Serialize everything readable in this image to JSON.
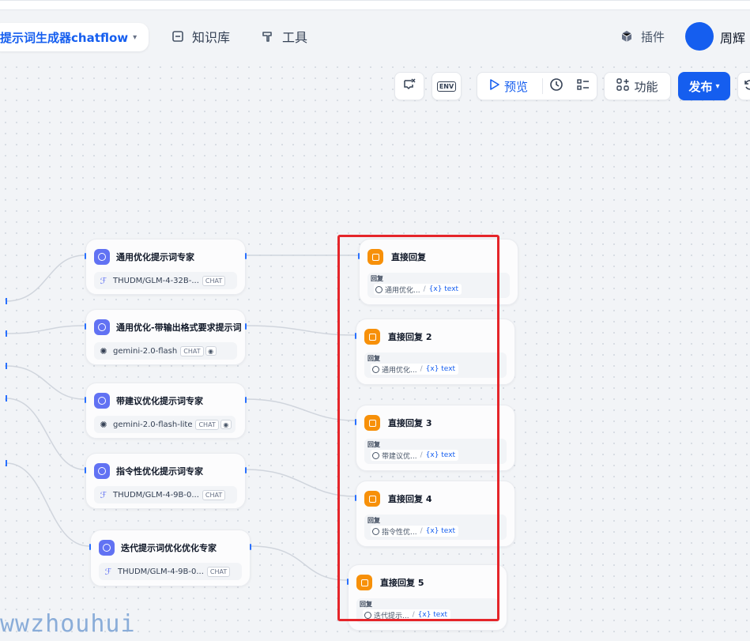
{
  "header": {
    "app_name": "提示词生成器chatflow",
    "nav": [
      {
        "label": "知识库",
        "icon": "book-icon"
      },
      {
        "label": "工具",
        "icon": "hammer-icon"
      }
    ],
    "plugins_label": "插件",
    "user_name": "周辉"
  },
  "toolbar": {
    "preview_label": "预览",
    "features_label": "功能",
    "publish_label": "发布",
    "env_label": "ENV"
  },
  "llm_nodes": [
    {
      "title": "通用优化提示词专家",
      "model": "THUDM/GLM-4-32B-...",
      "badge": "CHAT",
      "provider": "siliconflow"
    },
    {
      "title": "通用优化-带输出格式要求提示词",
      "model": "gemini-2.0-flash",
      "badge": "CHAT",
      "provider": "gemini"
    },
    {
      "title": "带建议优化提示词专家",
      "model": "gemini-2.0-flash-lite",
      "badge": "CHAT",
      "provider": "gemini"
    },
    {
      "title": "指令性优化提示词专家",
      "model": "THUDM/GLM-4-9B-0...",
      "badge": "CHAT",
      "provider": "siliconflow"
    },
    {
      "title": "迭代提示词优化优化专家",
      "model": "THUDM/GLM-4-9B-0...",
      "badge": "CHAT",
      "provider": "siliconflow"
    }
  ],
  "answer_nodes": [
    {
      "title": "直接回复",
      "reply_label": "回复",
      "source": "通用优化...",
      "var": "{x} text"
    },
    {
      "title": "直接回复 2",
      "reply_label": "回复",
      "source": "通用优化...",
      "var": "{x} text"
    },
    {
      "title": "直接回复 3",
      "reply_label": "回复",
      "source": "带建议优...",
      "var": "{x} text"
    },
    {
      "title": "直接回复 4",
      "reply_label": "回复",
      "source": "指令性优...",
      "var": "{x} text"
    },
    {
      "title": "直接回复 5",
      "reply_label": "回复",
      "source": "迭代提示...",
      "var": "{x} text"
    }
  ],
  "watermark": "wwzhouhui"
}
